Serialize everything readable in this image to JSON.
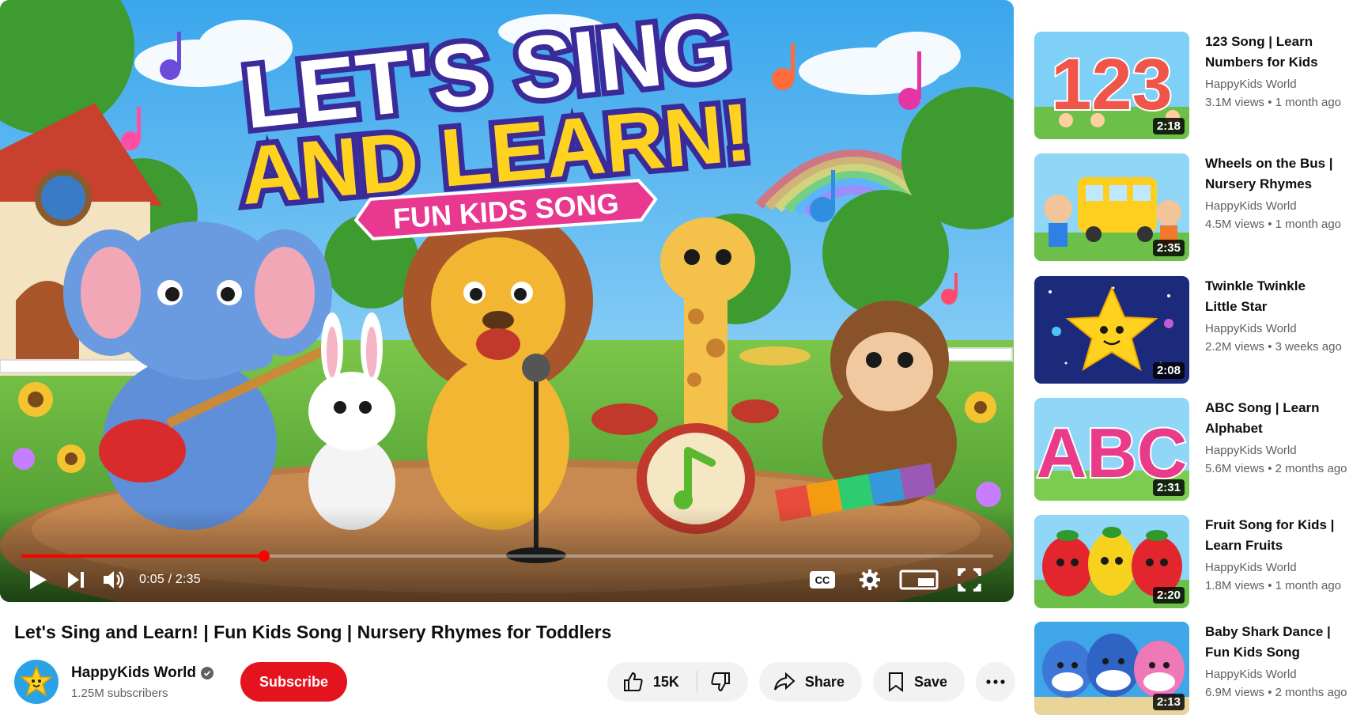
{
  "player": {
    "headline_line1": "LET'S SING",
    "headline_line2": "AND LEARN!",
    "banner": "FUN KIDS SONG",
    "current_time": "0:05",
    "time_separator": " / ",
    "duration": "2:35",
    "progress_fraction": 0.25,
    "cc_label": "CC",
    "accent_color": "#ff0000"
  },
  "video": {
    "title": "Let's Sing and Learn! | Fun Kids Song | Nursery Rhymes for Toddlers"
  },
  "channel": {
    "name": "HappyKids World",
    "subscribers": "1.25M subscribers",
    "verified": true
  },
  "actions": {
    "subscribe": "Subscribe",
    "like_count": "15K",
    "share": "Share",
    "save": "Save"
  },
  "recommendations": [
    {
      "title_1": "123 Song | Learn",
      "title_2": "Numbers for Kids",
      "channel": "HappyKids World",
      "stats": "3.1M views • 1 month ago",
      "duration": "2:18",
      "thumb_text": "123"
    },
    {
      "title_1": "Wheels on the Bus |",
      "title_2": "Nursery Rhymes",
      "channel": "HappyKids World",
      "stats": "4.5M views • 1 month ago",
      "duration": "2:35"
    },
    {
      "title_1": "Twinkle Twinkle",
      "title_2": "Little Star",
      "channel": "HappyKids World",
      "stats": "2.2M views • 3 weeks ago",
      "duration": "2:08"
    },
    {
      "title_1": "ABC Song | Learn",
      "title_2": "Alphabet",
      "channel": "HappyKids World",
      "stats": "5.6M views • 2 months ago",
      "duration": "2:31",
      "thumb_text": "ABC"
    },
    {
      "title_1": "Fruit Song for Kids |",
      "title_2": "Learn Fruits",
      "channel": "HappyKids World",
      "stats": "1.8M views • 1 month ago",
      "duration": "2:20"
    },
    {
      "title_1": "Baby Shark Dance |",
      "title_2": "Fun Kids Song",
      "channel": "HappyKids World",
      "stats": "6.9M views • 2 months ago",
      "duration": "2:13"
    }
  ],
  "colors": {
    "subscribe_bg": "#e4131e",
    "pill_bg": "#f2f2f2",
    "secondary_text": "#606060"
  },
  "icons": [
    "play-icon",
    "next-icon",
    "volume-icon",
    "captions-icon",
    "settings-icon",
    "miniplayer-icon",
    "fullscreen-icon",
    "like-icon",
    "dislike-icon",
    "share-icon",
    "save-icon",
    "more-icon",
    "verified-icon"
  ]
}
